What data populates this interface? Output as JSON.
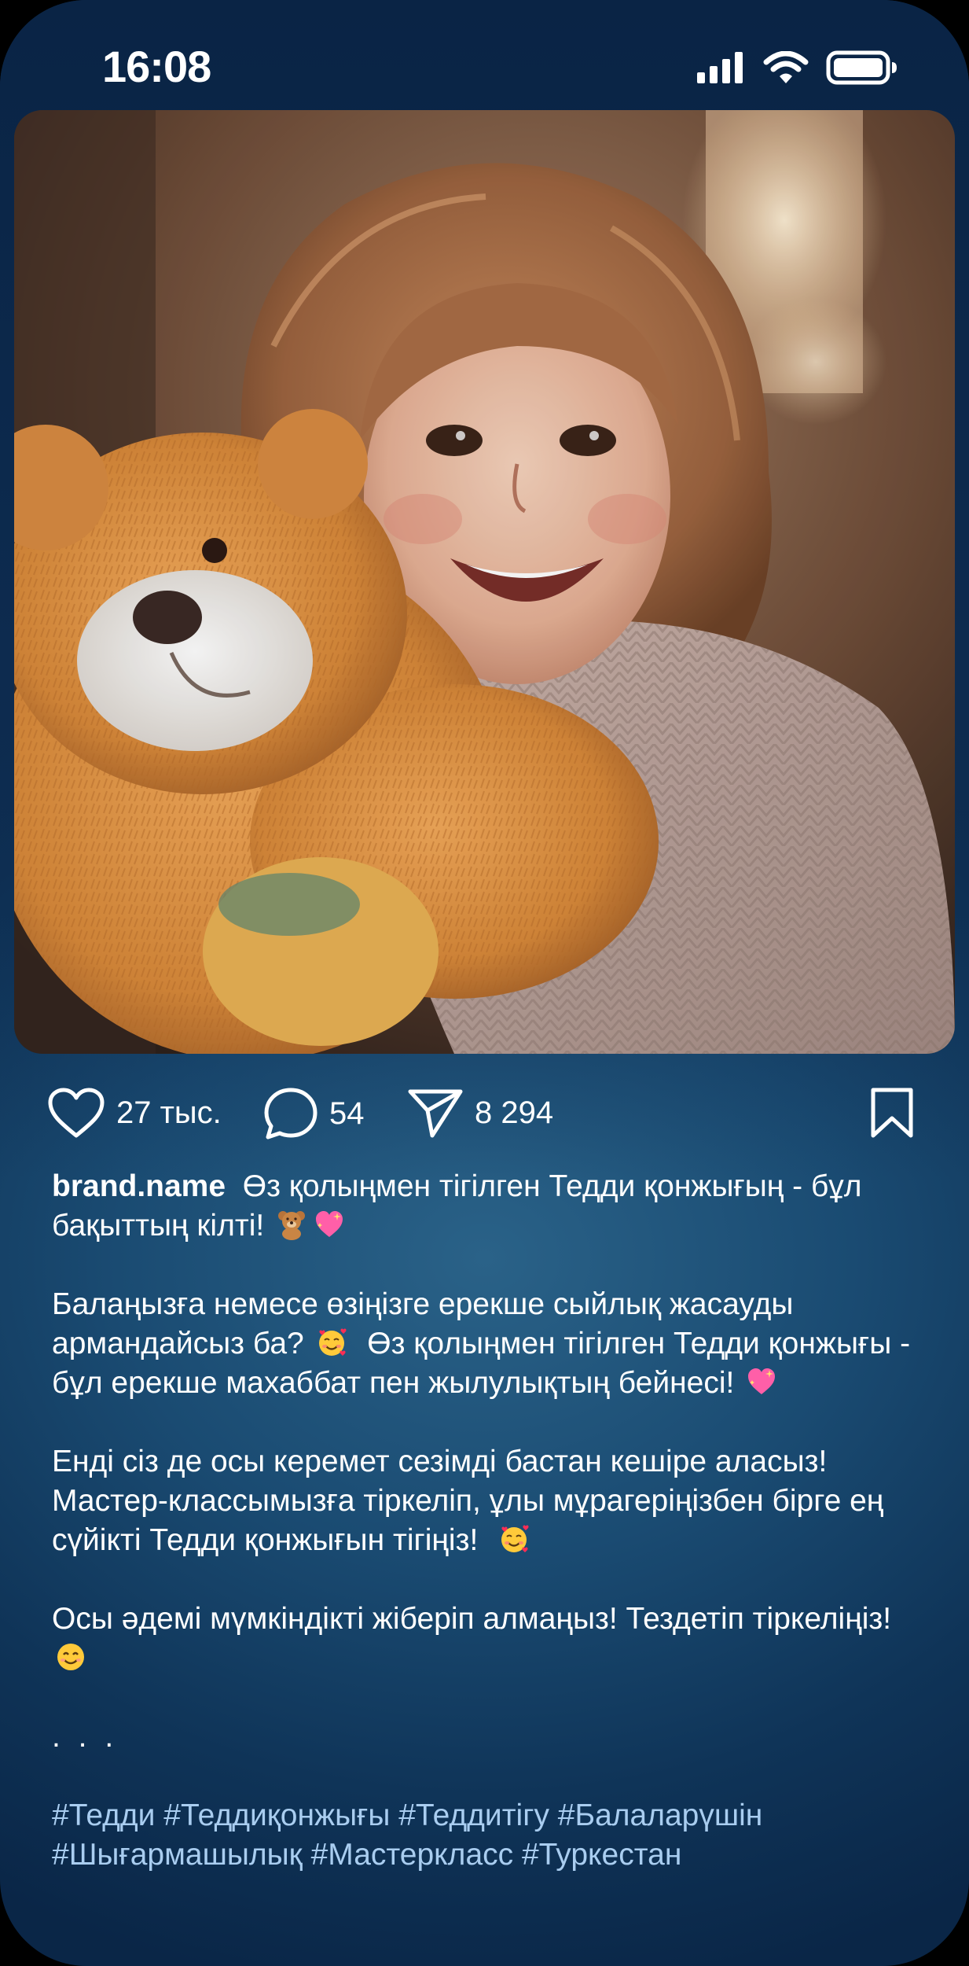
{
  "status_bar": {
    "time": "16:08",
    "icons": [
      "cellular-signal-icon",
      "wifi-icon",
      "battery-icon"
    ]
  },
  "post": {
    "image_alt": "Smiling girl hugging an orange teddy bear",
    "actions": {
      "likes": "27 тыс.",
      "comments": "54",
      "shares": "8 294"
    },
    "caption": {
      "username": "brand.name",
      "line1_a": "Өз қолыңмен тігілген Тедди қонжығың - бұл бақыттың кілті!",
      "para2_a": "Балаңызға немесе өзіңізге ерекше сыйлық жасауды армандайсыз ба?",
      "para2_b": "Өз қолыңмен тігілген Тедди қонжығы - бұл ерекше махаббат пен жылулықтың бейнесі!",
      "para3_a": "Енді сіз де осы керемет сезімді бастан кешіре аласыз!  Мастер-классымызға тіркеліп, ұлы мұрагеріңізбен бірге ең сүйікті Тедди қонжығын тігіңіз!",
      "para4_a": "Осы әдемі мүмкіндікті жіберіп алмаңыз!  Тездетіп тіркеліңіз!",
      "ellipsis": ". . .",
      "hashtags": "#Тедди #Теддиқонжығы #Теддитігу #Балаларүшін #Шығармашылық #Мастеркласс #Туркестан"
    }
  },
  "colors": {
    "background_top": "#0a2445",
    "background_mid": "#2a6288",
    "hashtag": "#a9cdf0",
    "text": "#ffffff"
  }
}
